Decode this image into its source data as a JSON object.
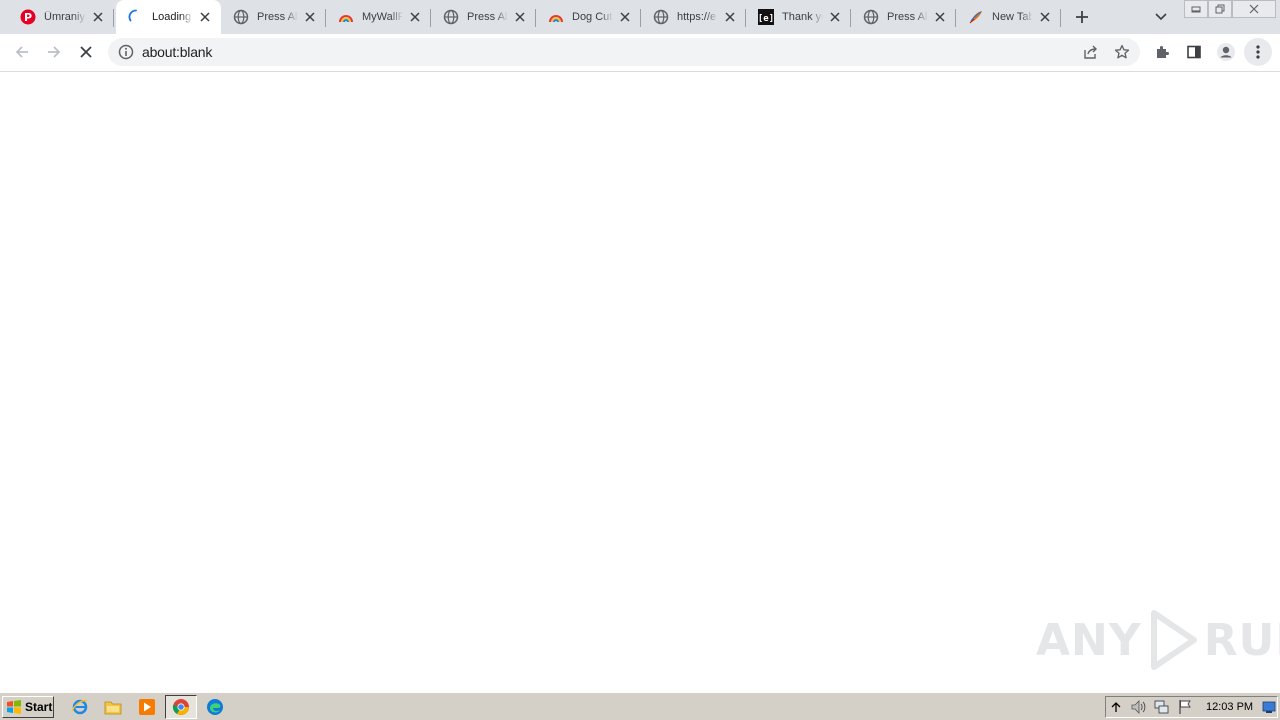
{
  "tabs": [
    {
      "title": "Ümraniye",
      "icon": "pinterest-icon",
      "active": false
    },
    {
      "title": "Loading...",
      "icon": "loading-spinner-icon",
      "active": true
    },
    {
      "title": "Press Allow",
      "icon": "globe-icon",
      "active": false
    },
    {
      "title": "MyWallPaper",
      "icon": "rainbow-icon",
      "active": false
    },
    {
      "title": "Press Allow",
      "icon": "globe-icon",
      "active": false
    },
    {
      "title": "Dog Cute",
      "icon": "rainbow-icon",
      "active": false
    },
    {
      "title": "https://e",
      "icon": "globe-icon",
      "active": false
    },
    {
      "title": "Thank you",
      "icon": "bracket-e-icon",
      "active": false
    },
    {
      "title": "Press Allow",
      "icon": "globe-icon",
      "active": false
    },
    {
      "title": "New Tab",
      "icon": "feather-icon",
      "active": false
    }
  ],
  "toolbar": {
    "url": "about:blank"
  },
  "watermark": {
    "text_left": "ANY",
    "text_right": "RUN"
  },
  "taskbar": {
    "start_label": "Start",
    "clock": "12:03 PM"
  }
}
